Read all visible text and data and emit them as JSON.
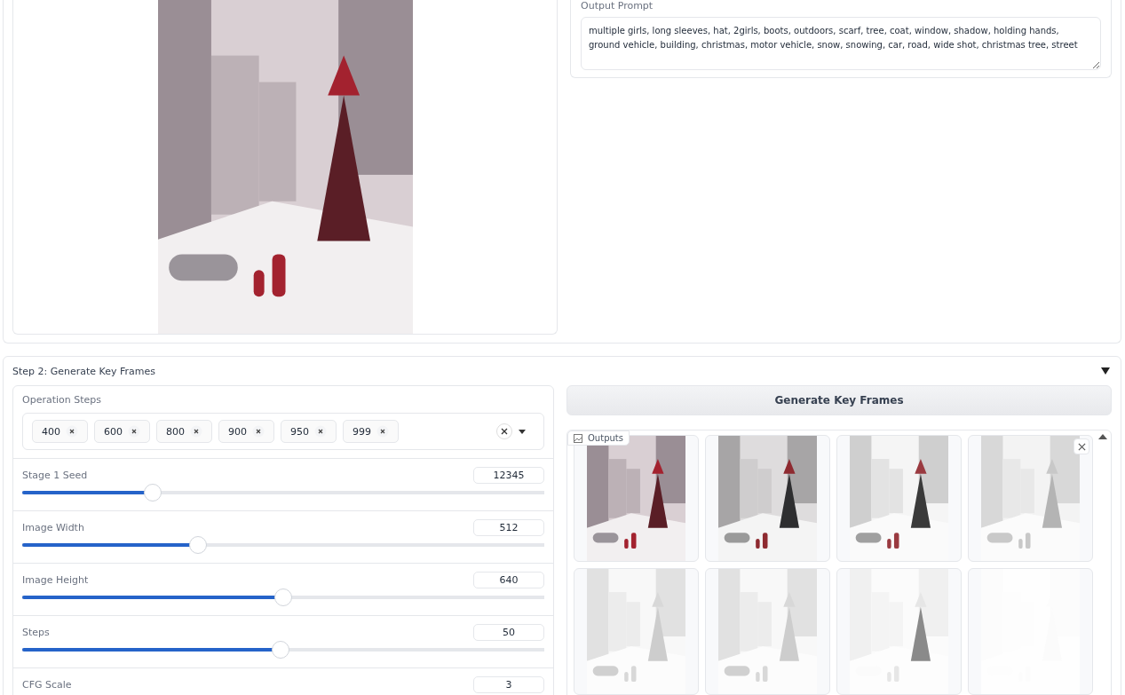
{
  "input_panel": {
    "output_prompt": {
      "label": "Output Prompt",
      "value": "multiple girls, long sleeves, hat, 2girls, boots, outdoors, scarf, tree, coat, window, shadow, holding hands, ground vehicle, building, christmas, motor vehicle, snow, snowing, car, road, wide shot, christmas tree, street"
    }
  },
  "step2": {
    "title": "Step 2: Generate Key Frames",
    "expanded": true,
    "operation_steps": {
      "label": "Operation Steps",
      "chips": [
        "400",
        "600",
        "800",
        "900",
        "950",
        "999"
      ]
    },
    "sliders": [
      {
        "label": "Stage 1 Seed",
        "value": "12345",
        "level": 0.25
      },
      {
        "label": "Image Width",
        "value": "512",
        "level": 0.336
      },
      {
        "label": "Image Height",
        "value": "640",
        "level": 0.5
      },
      {
        "label": "Steps",
        "value": "50",
        "level": 0.495
      },
      {
        "label": "CFG Scale",
        "value": "3"
      }
    ],
    "generate_button": "Generate Key Frames",
    "gallery": {
      "label": "Outputs",
      "thumbnails": [
        {
          "kind": "color"
        },
        {
          "kind": "gray"
        },
        {
          "kind": "ink"
        },
        {
          "kind": "pencil"
        },
        {
          "kind": "sketch"
        },
        {
          "kind": "sketch"
        },
        {
          "kind": "faint"
        },
        {
          "kind": "blank"
        }
      ]
    }
  }
}
